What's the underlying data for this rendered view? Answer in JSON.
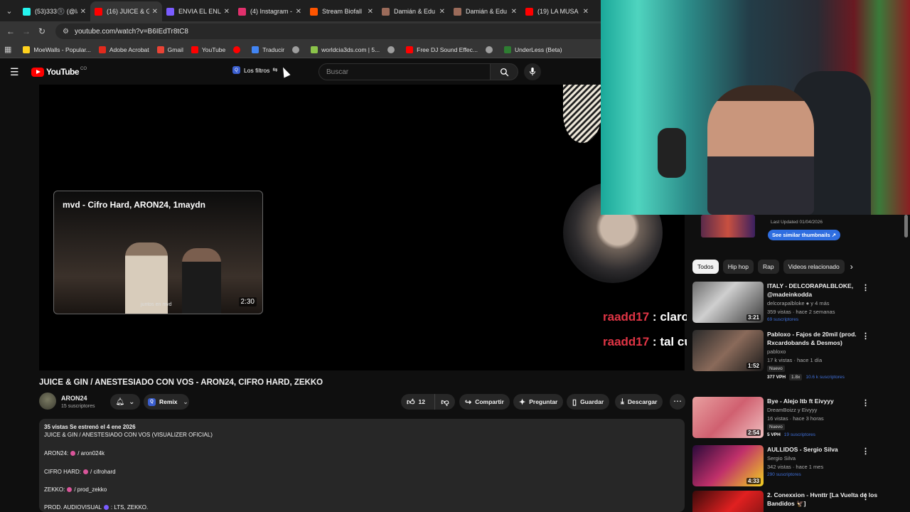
{
  "browser": {
    "tabs": [
      {
        "title": "(53)333®️ (@la",
        "color": "#25f4ee",
        "active": false
      },
      {
        "title": "(16) JUICE & G",
        "color": "#ff0000",
        "active": true
      },
      {
        "title": "ENVIA EL ENLA",
        "color": "#7a5cff",
        "active": false
      },
      {
        "title": "(4) Instagram -",
        "color": "#e1306c",
        "active": false
      },
      {
        "title": "Stream Biofall",
        "color": "#ff5500",
        "active": false
      },
      {
        "title": "Damián & Edu",
        "color": "#9b6b5a",
        "active": false
      },
      {
        "title": "Damián & Edu",
        "color": "#9b6b5a",
        "active": false
      },
      {
        "title": "(19) LA MUSA",
        "color": "#ff0000",
        "active": false
      }
    ],
    "url": "youtube.com/watch?v=B6IEdTr8tC8",
    "bookmarks": [
      {
        "label": "MoeWalls - Popular...",
        "color": "#ffd21e"
      },
      {
        "label": "Adobe Acrobat",
        "color": "#e22a1d"
      },
      {
        "label": "Gmail",
        "color": "#ea4335"
      },
      {
        "label": "YouTube",
        "color": "#ff0000"
      },
      {
        "label": "",
        "color": "#ff0000"
      },
      {
        "label": "Traducir",
        "color": "#4285f4"
      },
      {
        "label": "",
        "color": "#9e9e9e"
      },
      {
        "label": "worldcia3ds.com | 5...",
        "color": "#8bc34a"
      },
      {
        "label": "",
        "color": "#9e9e9e"
      },
      {
        "label": "Free DJ Sound Effec...",
        "color": "#ff0000"
      },
      {
        "label": "",
        "color": "#9e9e9e"
      },
      {
        "label": "UnderLess (Beta)",
        "color": "#2e7d32"
      }
    ]
  },
  "youtube": {
    "logo_text": "YouTube",
    "country": "CO",
    "filters_label": "Los filtros",
    "search_placeholder": "Buscar"
  },
  "player": {
    "card_title": "mvd - Cifro Hard, ARON24, 1maydn",
    "card_caption": "juntos en mvd",
    "card_duration": "2:30"
  },
  "chat": [
    {
      "user": "raadd17",
      "sep": " : ",
      "msg": "claro sisi"
    },
    {
      "user": "raadd17",
      "sep": " : ",
      "msg": "tal cual"
    }
  ],
  "video": {
    "title": "JUICE & GIN / ANESTESIADO CON VOS - ARON24, CIFRO HARD, ZEKKO",
    "channel": "ARON24",
    "subscribers": "15 suscriptores",
    "remix": "Remix",
    "likes": "12",
    "share": "Compartir",
    "ask": "Preguntar",
    "save": "Guardar",
    "download": "Descargar"
  },
  "description": {
    "meta": "35 vistas  Se estrenó el 4 ene 2026",
    "line1": "JUICE & GIN / ANESTESIADO CON VOS (VISUALIZER OFICIAL)",
    "credits": [
      {
        "label": "ARON24:",
        "handle": "/ aron024k"
      },
      {
        "label": "CIFRO HARD:",
        "handle": "/ cifrohard"
      },
      {
        "label": "ZEKKO:",
        "handle": "/ prod_zekko"
      },
      {
        "label": "PROD. AUDIOVISUAL",
        "handle": ": LTS, ZEKKO."
      }
    ]
  },
  "sidebar": {
    "last_updated": "Last Updated 01/04/2026",
    "similar_button": "See similar thumbnails ↗",
    "chips": [
      "Todos",
      "Hip hop",
      "Rap",
      "Videos relacionado"
    ],
    "recommendations": [
      {
        "title": "ITALY - DELCORAPALBLOKE, @madeinkodda",
        "channel": "delcorapalbloke ● y 4 más",
        "stats": "359 vistas · hace 2 semanas",
        "extra": "69 suscriptores",
        "duration": "3:21",
        "badge": "",
        "vph": "",
        "ratio": "",
        "thumb": "linear-gradient(135deg,#6b6b6b,#cfcfcf 40%,#3a3a3a)"
      },
      {
        "title": "Pabloxo - Fajos de 20mil (prod. Rxcardobands & Desmos)",
        "channel": "pabloxo",
        "stats": "17 k vistas · hace 1 día",
        "extra": "10.6 k suscriptores",
        "duration": "1:52",
        "badge": "Nuevo",
        "vph": "377 VPH",
        "ratio": "1.8x",
        "thumb": "linear-gradient(135deg,#2a2a2a,#8a6a5a 50%,#1a1a1a)"
      },
      {
        "title": "Bye - Alejo ltb ft Eivyyy",
        "channel": "DreamBoizz y Eivyyy",
        "stats": "16 vistas · hace 3 horas",
        "extra": "19 suscriptores",
        "duration": "2:54",
        "badge": "Nuevo",
        "vph": "5 VPH",
        "ratio": "",
        "thumb": "linear-gradient(135deg,#e8a0a0,#d06070 50%,#f0c0c0)"
      },
      {
        "title": "AULLIDOS - Sergio Silva",
        "channel": "Sergio Silva",
        "stats": "342 vistas · hace 1 mes",
        "extra": "290 suscriptores",
        "duration": "4:33",
        "badge": "",
        "vph": "",
        "ratio": "",
        "thumb": "linear-gradient(135deg,#2a0a3a,#c0306a 50%,#f0d020)"
      },
      {
        "title": "2. Conexxion - Hvnttr [La Vuelta de los Bandidos 🦅]",
        "channel": "",
        "stats": "",
        "extra": "",
        "duration": "",
        "badge": "",
        "vph": "",
        "ratio": "",
        "thumb": "linear-gradient(135deg,#3a0a0a,#e02020 50%,#6a1010)"
      }
    ]
  }
}
